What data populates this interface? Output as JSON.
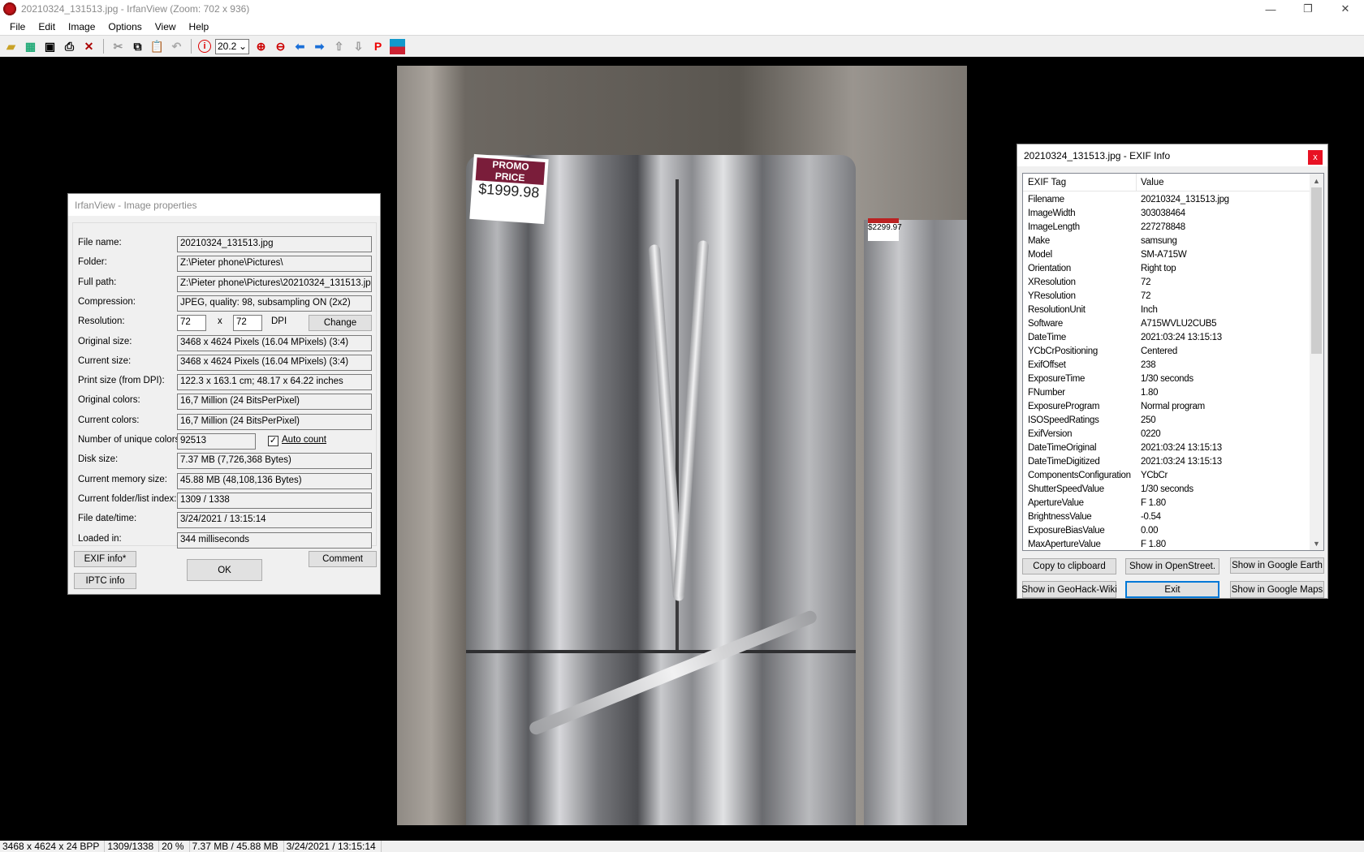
{
  "window": {
    "title": "20210324_131513.jpg - IrfanView (Zoom: 702 x 936)",
    "minimize": "—",
    "restore": "❐",
    "close": "✕"
  },
  "menu": [
    "File",
    "Edit",
    "Image",
    "Options",
    "View",
    "Help"
  ],
  "toolbar": {
    "zoom_value": "20.2",
    "icons": [
      "open-folder",
      "slideshow",
      "save",
      "print",
      "delete",
      "cut",
      "copy",
      "paste",
      "undo",
      "info",
      "zoom-in",
      "zoom-out",
      "previous",
      "next",
      "first",
      "last",
      "paint",
      "thumbnails"
    ]
  },
  "photo": {
    "promo_label": "PROMO PRICE",
    "promo_price": "$1999.98",
    "second_price": "$2299.97"
  },
  "properties": {
    "title": "IrfanView - Image properties",
    "rows": [
      {
        "label": "File name:",
        "value": "20210324_131513.jpg"
      },
      {
        "label": "Folder:",
        "value": "Z:\\Pieter phone\\Pictures\\"
      },
      {
        "label": "Full path:",
        "value": "Z:\\Pieter phone\\Pictures\\20210324_131513.jpg"
      },
      {
        "label": "Compression:",
        "value": "JPEG, quality: 98, subsampling ON (2x2)"
      },
      {
        "label": "Resolution:",
        "value": ""
      },
      {
        "label": "Original size:",
        "value": "3468 x 4624  Pixels (16.04 MPixels) (3:4)"
      },
      {
        "label": "Current size:",
        "value": "3468 x 4624  Pixels (16.04 MPixels) (3:4)"
      },
      {
        "label": "Print size (from DPI):",
        "value": "122.3 x 163.1 cm; 48.17 x 64.22 inches"
      },
      {
        "label": "Original colors:",
        "value": "16,7 Million   (24 BitsPerPixel)"
      },
      {
        "label": "Current colors:",
        "value": "16,7 Million   (24 BitsPerPixel)"
      },
      {
        "label": "Number of unique colors:",
        "value": ""
      },
      {
        "label": "Disk size:",
        "value": "7.37 MB (7,726,368 Bytes)"
      },
      {
        "label": "Current memory size:",
        "value": "45.88  MB (48,108,136 Bytes)"
      },
      {
        "label": "Current folder/list index:",
        "value": "1309  /  1338"
      },
      {
        "label": "File date/time:",
        "value": "3/24/2021 / 13:15:14"
      },
      {
        "label": "Loaded in:",
        "value": "344 milliseconds"
      }
    ],
    "dpi_x": "72",
    "dpi_sep": "x",
    "dpi_y": "72",
    "dpi_unit": "DPI",
    "change_button": "Change",
    "unique_colors": "92513",
    "auto_count_label": "Auto count",
    "auto_count_checked": true,
    "exif_button": "EXIF info*",
    "iptc_button": "IPTC info",
    "ok_button": "OK",
    "comment_button": "Comment"
  },
  "exif": {
    "title": "20210324_131513.jpg - EXIF Info",
    "close": "x",
    "col_tag": "EXIF Tag",
    "col_value": "Value",
    "rows": [
      [
        "Filename",
        "20210324_131513.jpg"
      ],
      [
        "ImageWidth",
        "303038464"
      ],
      [
        "ImageLength",
        "227278848"
      ],
      [
        "Make",
        "samsung"
      ],
      [
        "Model",
        "SM-A715W"
      ],
      [
        "Orientation",
        "Right top"
      ],
      [
        "XResolution",
        "72"
      ],
      [
        "YResolution",
        "72"
      ],
      [
        "ResolutionUnit",
        "Inch"
      ],
      [
        "Software",
        "A715WVLU2CUB5"
      ],
      [
        "DateTime",
        "2021:03:24 13:15:13"
      ],
      [
        "YCbCrPositioning",
        "Centered"
      ],
      [
        "ExifOffset",
        "238"
      ],
      [
        "ExposureTime",
        "1/30 seconds"
      ],
      [
        "FNumber",
        "1.80"
      ],
      [
        "ExposureProgram",
        "Normal program"
      ],
      [
        "ISOSpeedRatings",
        "250"
      ],
      [
        "ExifVersion",
        "0220"
      ],
      [
        "DateTimeOriginal",
        "2021:03:24 13:15:13"
      ],
      [
        "DateTimeDigitized",
        "2021:03:24 13:15:13"
      ],
      [
        "ComponentsConfiguration",
        "YCbCr"
      ],
      [
        "ShutterSpeedValue",
        "1/30 seconds"
      ],
      [
        "ApertureValue",
        "F 1.80"
      ],
      [
        "BrightnessValue",
        "-0.54"
      ],
      [
        "ExposureBiasValue",
        "0.00"
      ],
      [
        "MaxApertureValue",
        "F 1.80"
      ]
    ],
    "buttons": {
      "copy": "Copy to clipboard",
      "openstreet": "Show in OpenStreet.",
      "google_earth": "Show in Google Earth",
      "geohack": "Show in GeoHack-Wiki",
      "exit": "Exit",
      "google_maps": "Show in Google Maps"
    }
  },
  "status": [
    "3468 x 4624 x 24 BPP",
    "1309/1338",
    "20 %",
    "7.37 MB / 45.88 MB",
    "3/24/2021 / 13:15:14"
  ]
}
